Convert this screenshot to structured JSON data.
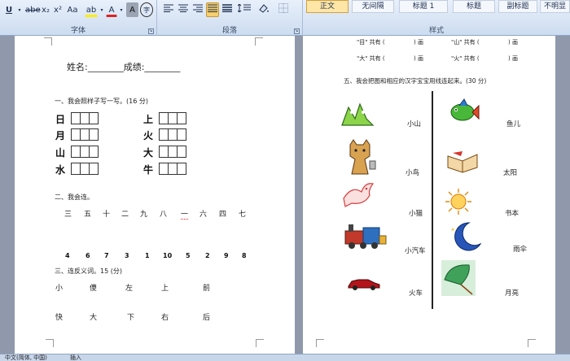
{
  "ribbon": {
    "groups": {
      "font": "字体",
      "paragraph": "段落",
      "styles": "样式"
    },
    "font_buttons": {
      "underline": "U",
      "strike": "abe",
      "subscript": "x₂",
      "superscript": "x²",
      "change_case": "Aa",
      "highlight": "ab",
      "font_color": "A",
      "char_shading": "A",
      "enclose": "字"
    },
    "styles": [
      "正文",
      "无间隔",
      "标题 1",
      "标题",
      "副标题",
      "不明显强调"
    ],
    "active_style": "正文"
  },
  "left_page": {
    "name_line": "姓名:________成绩:________",
    "section1_title": "一、我会照样子写一写。(16 分)",
    "section1_chars_left": [
      "日",
      "月",
      "山",
      "水"
    ],
    "section1_chars_right": [
      "上",
      "火",
      "大",
      "牛"
    ],
    "section2_title": "二、我会连。",
    "section2_chars": [
      "三",
      "五",
      "十",
      "二",
      "九",
      "八",
      "一",
      "六",
      "四",
      "七"
    ],
    "section2_numbers": [
      "4",
      "6",
      "7",
      "3",
      "1",
      "10",
      "5",
      "2",
      "9",
      "8"
    ],
    "section3_title": "三、连反义词。15 (分)",
    "section3_row1": [
      "小",
      "傻",
      "左",
      "上",
      "前"
    ],
    "section3_row2": [
      "快",
      "大",
      "下",
      "右",
      "后"
    ]
  },
  "right_page": {
    "top_lines": [
      {
        "left": "\"目\" 共有 (",
        "left_unit": ") 画",
        "right": "\"山\" 共有 (",
        "right_unit": ") 画"
      },
      {
        "left": "\"大\" 共有 (",
        "left_unit": ") 画",
        "right": "\"火\" 共有 (",
        "right_unit": ") 画"
      }
    ],
    "section5_title": "五、我会把图和相应的汉字宝宝用线连起来。(30 分)",
    "left_words": [
      "小山",
      "小鸟",
      "小猫",
      "小汽车",
      "火车"
    ],
    "right_words": [
      "鱼儿",
      "太阳",
      "书本",
      "雨伞",
      "月亮"
    ]
  },
  "status": {
    "language": "中文(简体, 中国)",
    "insert": "插入"
  },
  "colors": {
    "ribbon_top": "#e8f0fb",
    "ribbon_bottom": "#cddcf0",
    "doc_background": "#8f99ab",
    "accent": "#f8cf6a"
  }
}
